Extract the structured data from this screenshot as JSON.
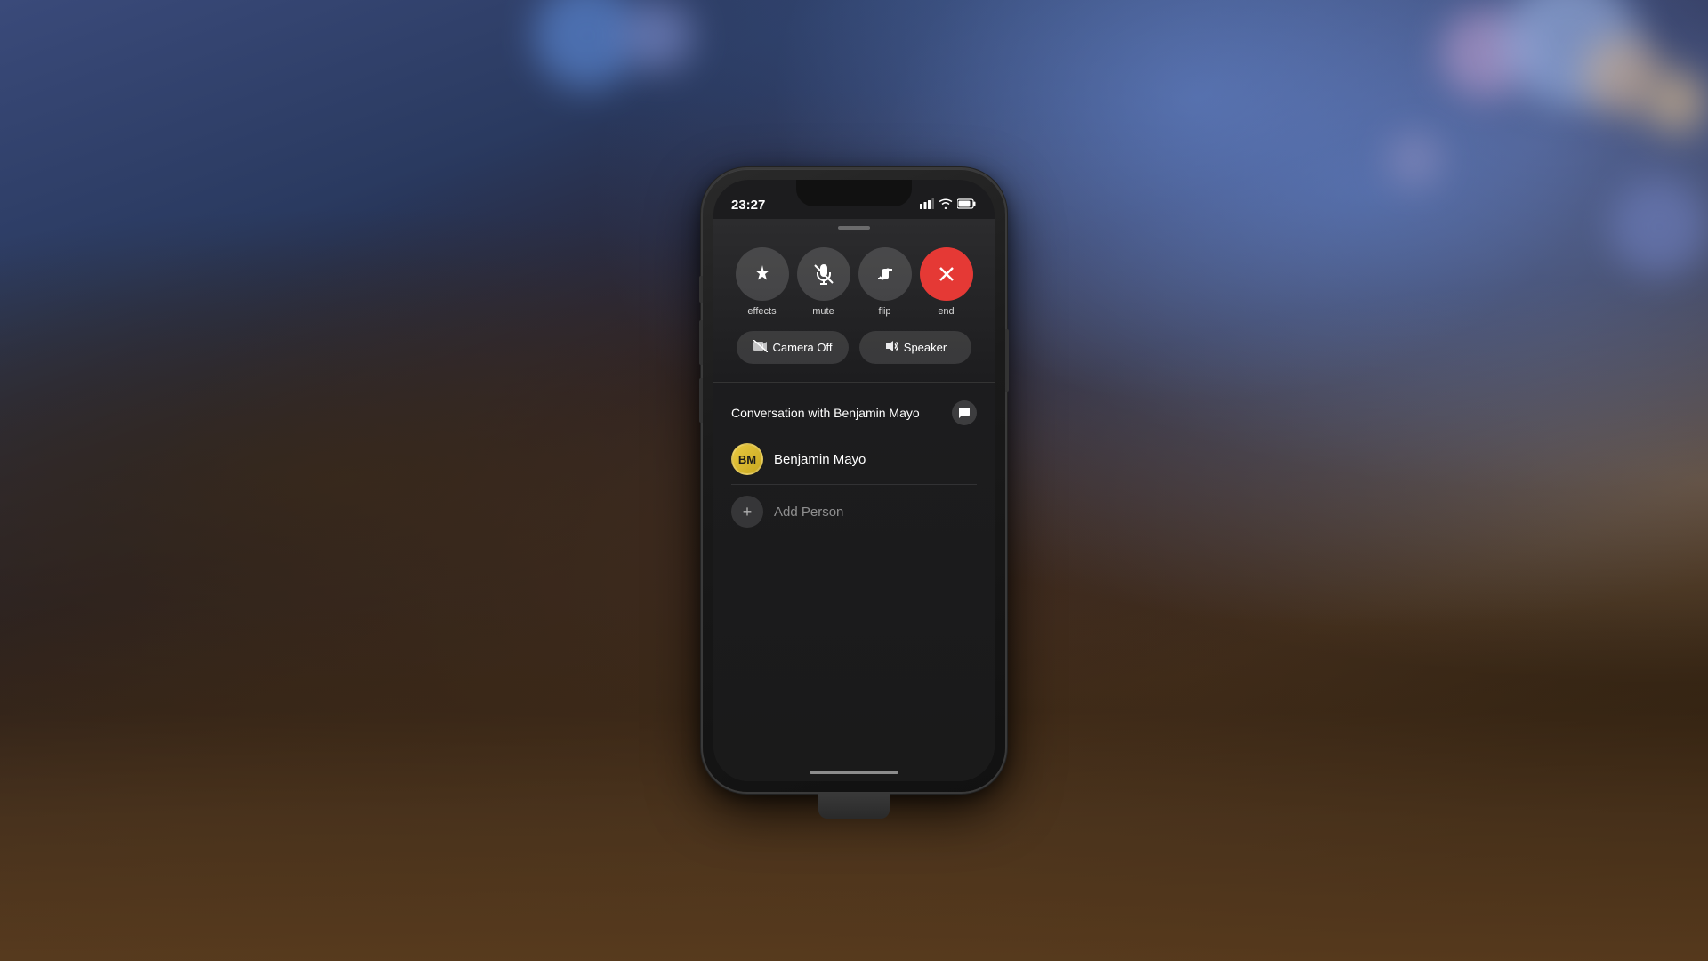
{
  "background": {
    "description": "Bokeh background with desk surface"
  },
  "phone": {
    "status_bar": {
      "time": "23:27",
      "signal_icon": "▌▌",
      "wifi_icon": "wifi",
      "battery_icon": "battery"
    },
    "call_controls": {
      "buttons": [
        {
          "id": "effects",
          "label": "effects",
          "icon": "✦",
          "type": "normal"
        },
        {
          "id": "mute",
          "label": "mute",
          "icon": "mic-off",
          "type": "normal"
        },
        {
          "id": "flip",
          "label": "flip",
          "icon": "camera-flip",
          "type": "normal"
        },
        {
          "id": "end",
          "label": "end",
          "icon": "✕",
          "type": "end"
        }
      ],
      "secondary_buttons": [
        {
          "id": "camera-off",
          "label": "Camera Off",
          "icon": "camera-off"
        },
        {
          "id": "speaker",
          "label": "Speaker",
          "icon": "speaker"
        }
      ]
    },
    "conversation": {
      "title": "Conversation with Benjamin Mayo",
      "message_icon": "💬",
      "contact": {
        "initials": "BM",
        "name": "Benjamin Mayo"
      },
      "add_person_label": "Add Person"
    },
    "home_indicator": true
  }
}
